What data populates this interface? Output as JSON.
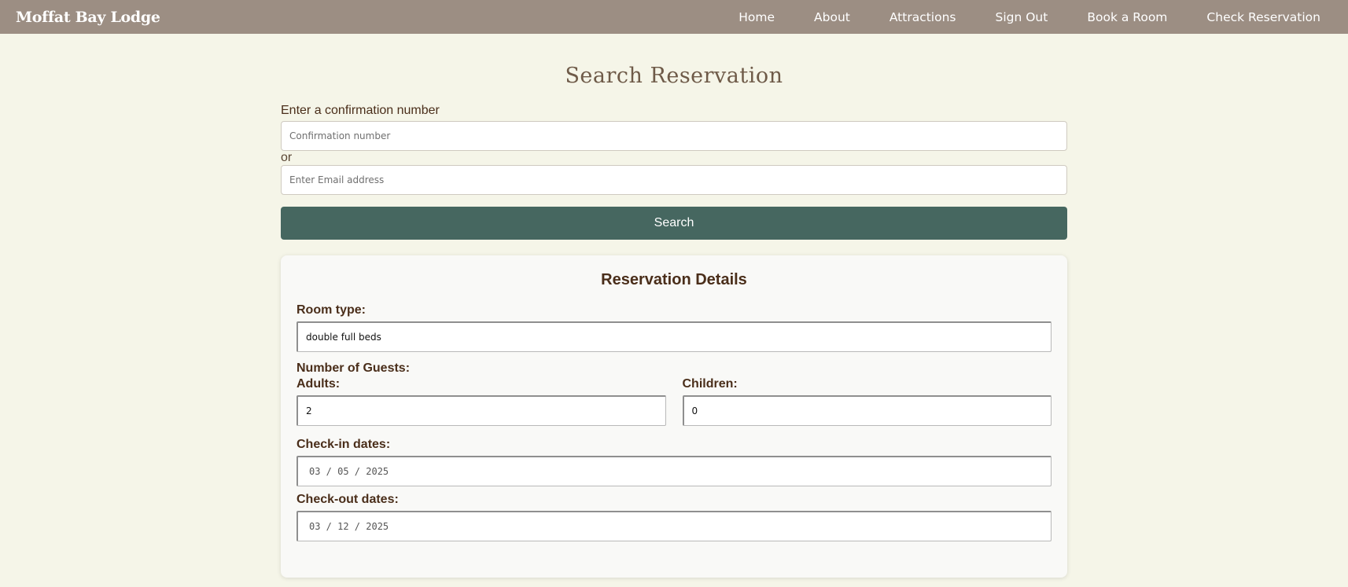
{
  "nav": {
    "brand": "Moffat Bay Lodge",
    "links": [
      "Home",
      "About",
      "Attractions",
      "Sign Out",
      "Book a Room",
      "Check Reservation"
    ]
  },
  "search": {
    "title": "Search Reservation",
    "confirmation_label": "Enter a confirmation number",
    "confirmation_placeholder": "Confirmation number",
    "or_text": "or",
    "email_placeholder": "Enter Email address",
    "search_button": "Search"
  },
  "details": {
    "title": "Reservation Details",
    "room_type_label": "Room type:",
    "room_type_value": "double full beds",
    "guests_label": "Number of Guests:",
    "adults_label": "Adults:",
    "adults_value": "2",
    "children_label": "Children:",
    "children_value": "0",
    "checkin_label": "Check-in dates:",
    "checkin_value": "03 / 05 / 2025",
    "checkout_label": "Check-out dates:",
    "checkout_value": "03 / 12 / 2025"
  },
  "colors": {
    "navbar": "#9c8e83",
    "background": "#f5f5e8",
    "button": "#466760",
    "text": "#4a2e1a"
  }
}
